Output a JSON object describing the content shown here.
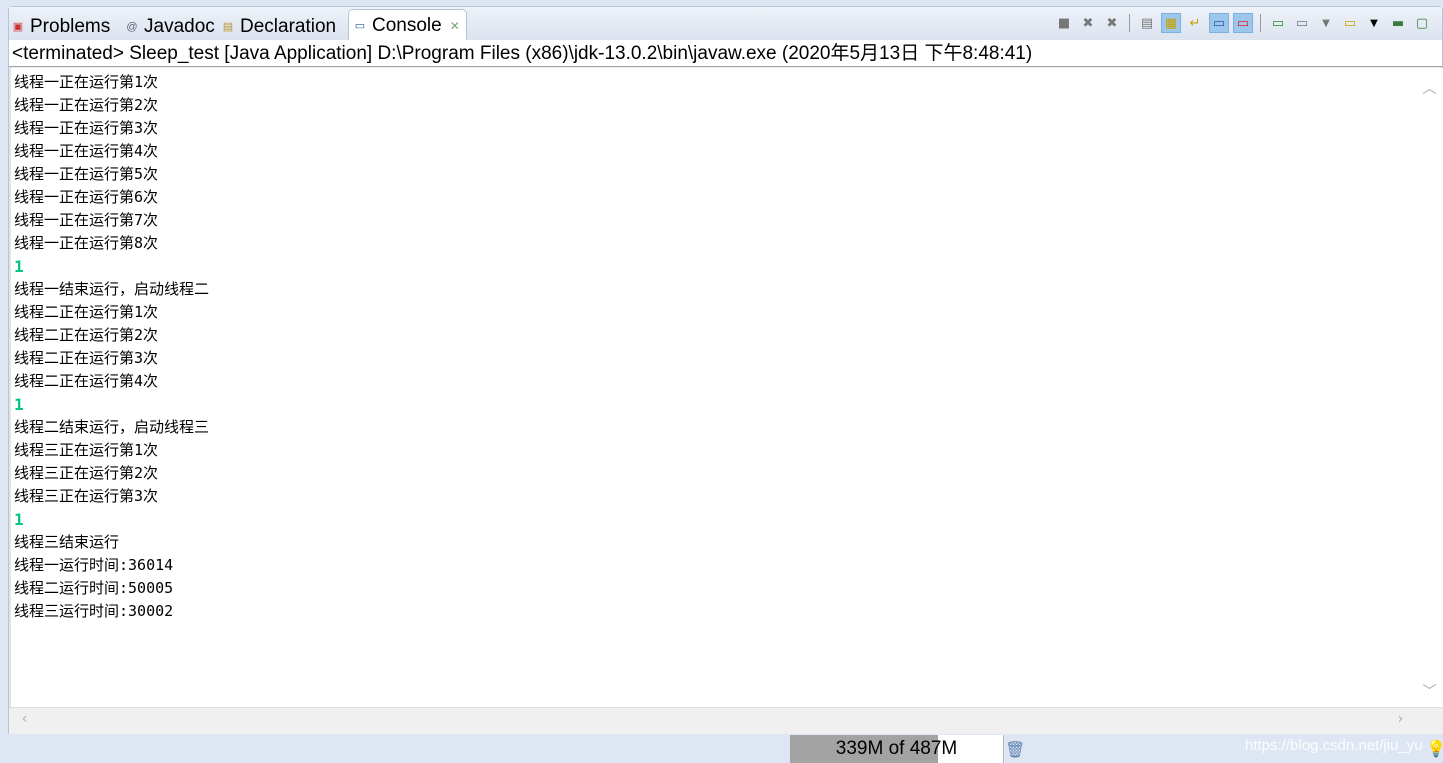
{
  "tabs": [
    {
      "label": "Problems",
      "icon": "problems-icon"
    },
    {
      "label": "Javadoc",
      "icon": "at-icon"
    },
    {
      "label": "Declaration",
      "icon": "declaration-icon"
    },
    {
      "label": "Console",
      "icon": "console-icon",
      "active": true
    }
  ],
  "description": "<terminated> Sleep_test [Java Application] D:\\Program Files (x86)\\jdk-13.0.2\\bin\\javaw.exe (2020年5月13日 下午8:48:41)",
  "console_lines": [
    {
      "text": "线程一正在运行第1次"
    },
    {
      "text": "线程一正在运行第2次"
    },
    {
      "text": "线程一正在运行第3次"
    },
    {
      "text": "线程一正在运行第4次"
    },
    {
      "text": "线程一正在运行第5次"
    },
    {
      "text": "线程一正在运行第6次"
    },
    {
      "text": "线程一正在运行第7次"
    },
    {
      "text": "线程一正在运行第8次"
    },
    {
      "text": "1",
      "green": true
    },
    {
      "text": "线程一结束运行，启动线程二"
    },
    {
      "text": "线程二正在运行第1次"
    },
    {
      "text": "线程二正在运行第2次"
    },
    {
      "text": "线程二正在运行第3次"
    },
    {
      "text": "线程二正在运行第4次"
    },
    {
      "text": "1",
      "green": true
    },
    {
      "text": "线程二结束运行，启动线程三"
    },
    {
      "text": "线程三正在运行第1次"
    },
    {
      "text": "线程三正在运行第2次"
    },
    {
      "text": "线程三正在运行第3次"
    },
    {
      "text": "1",
      "green": true
    },
    {
      "text": "线程三结束运行"
    },
    {
      "text": "线程一运行时间:36014"
    },
    {
      "text": "线程二运行时间:50005"
    },
    {
      "text": "线程三运行时间:30002"
    }
  ],
  "status": {
    "heap": "339M of 487M",
    "heap_used_fraction": 0.696,
    "watermark": "https://blog.csdn.net/jiu_yu"
  },
  "colors": {
    "stdout_green": "#00c48a",
    "heap_fill": "#a3a3a3"
  }
}
